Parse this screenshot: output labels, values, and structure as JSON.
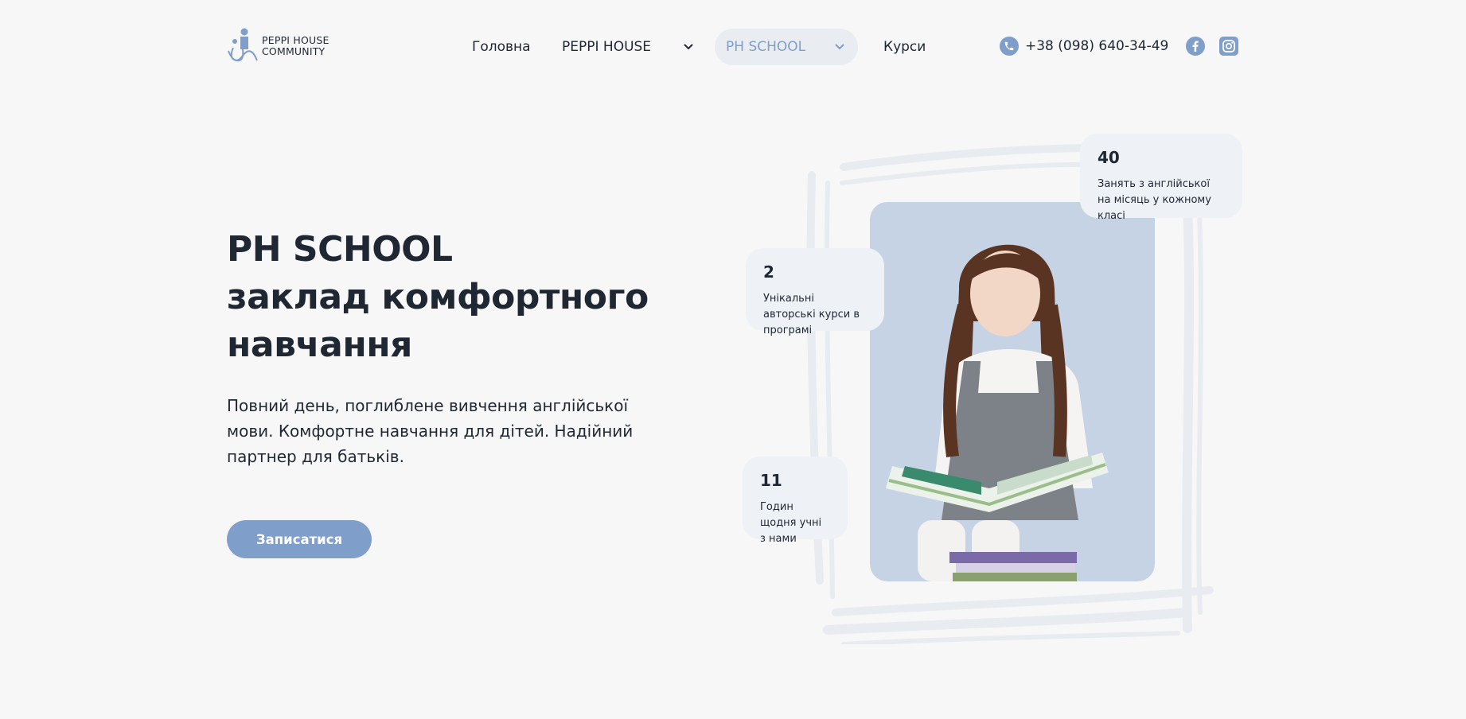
{
  "header": {
    "logo_line1": "PEPPI HOUSE",
    "logo_line2": "COMMUNITY",
    "nav": [
      {
        "label": "Головна"
      },
      {
        "label": "PEPPI HOUSE"
      },
      {
        "label": "PH SCHOOL"
      },
      {
        "label": "Курси"
      }
    ],
    "phone": "+38 (098) 640-34-49",
    "social_icons": [
      "facebook-icon",
      "instagram-icon"
    ]
  },
  "hero": {
    "title_line1": "PH SCHOOL",
    "title_line2": "заклад комфортного",
    "title_line3": "навчання",
    "description": "Повний день, поглиблене вивчення англійської мови. Комфортне навчання для дітей. Надійний партнер для батьків.",
    "cta_label": "Записатися"
  },
  "stats": [
    {
      "number": "40",
      "text": "Занять з англійської на місяць у кожному класі"
    },
    {
      "number": "2",
      "text": "Унікальні авторські курси в програмі"
    },
    {
      "number": "11",
      "text": "Годин щодня учні з нами"
    }
  ],
  "colors": {
    "accent": "#7f9ec9",
    "text": "#1f2733",
    "background": "#f7f7f7",
    "card": "#eef1f5",
    "photo_bg": "#c6d3e5"
  }
}
